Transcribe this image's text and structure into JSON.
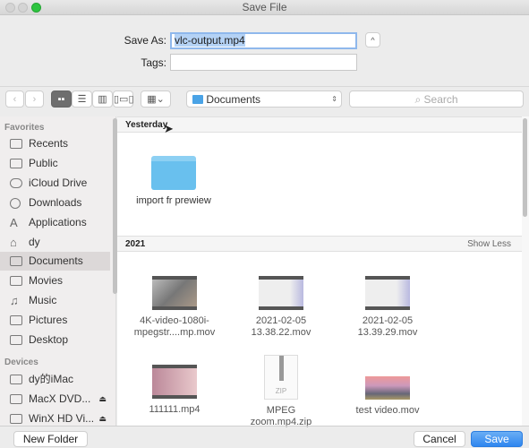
{
  "window": {
    "title": "Save File"
  },
  "form": {
    "save_as_label": "Save As:",
    "save_as_value": "vlc-output.mp4",
    "tags_label": "Tags:",
    "tags_value": "",
    "expand_icon": "chevron-up-icon"
  },
  "toolbar": {
    "location": "Documents",
    "search_placeholder": "Search",
    "view_modes": [
      "icon",
      "list",
      "column",
      "cover-flow"
    ],
    "arrange_icon": "grid-icon"
  },
  "sidebar": {
    "favorites_header": "Favorites",
    "favorites": [
      {
        "label": "Recents"
      },
      {
        "label": "Public"
      },
      {
        "label": "iCloud Drive"
      },
      {
        "label": "Downloads"
      },
      {
        "label": "Applications"
      },
      {
        "label": "dy"
      },
      {
        "label": "Documents",
        "selected": true
      },
      {
        "label": "Movies"
      },
      {
        "label": "Music"
      },
      {
        "label": "Pictures"
      },
      {
        "label": "Desktop"
      }
    ],
    "devices_header": "Devices",
    "devices": [
      {
        "label": "dy的iMac"
      },
      {
        "label": "MacX DVD..."
      },
      {
        "label": "WinX HD Vi..."
      }
    ]
  },
  "main": {
    "groups": [
      {
        "title": "Yesterday",
        "items": [
          {
            "name": "import fr prewiew",
            "type": "folder"
          }
        ]
      },
      {
        "title": "2021",
        "action": "Show Less",
        "items": [
          {
            "line1": "4K-video-1080i-",
            "line2": "mpegstr....mp.mov"
          },
          {
            "line1": "2021-02-05",
            "line2": "13.38.22.mov"
          },
          {
            "line1": "2021-02-05",
            "line2": "13.39.29.mov"
          },
          {
            "line1": "111111.mp4",
            "line2": ""
          },
          {
            "line1": "MPEG",
            "line2": "zoom.mp4.zip",
            "badge": "ZIP"
          },
          {
            "line1": "test video.mov",
            "line2": ""
          }
        ]
      }
    ]
  },
  "buttons": {
    "new_folder": "New Folder",
    "cancel": "Cancel",
    "save": "Save"
  },
  "colors": {
    "accent": "#3b8ff0",
    "selection": "#b4d2f5",
    "folder": "#69c0ee"
  }
}
